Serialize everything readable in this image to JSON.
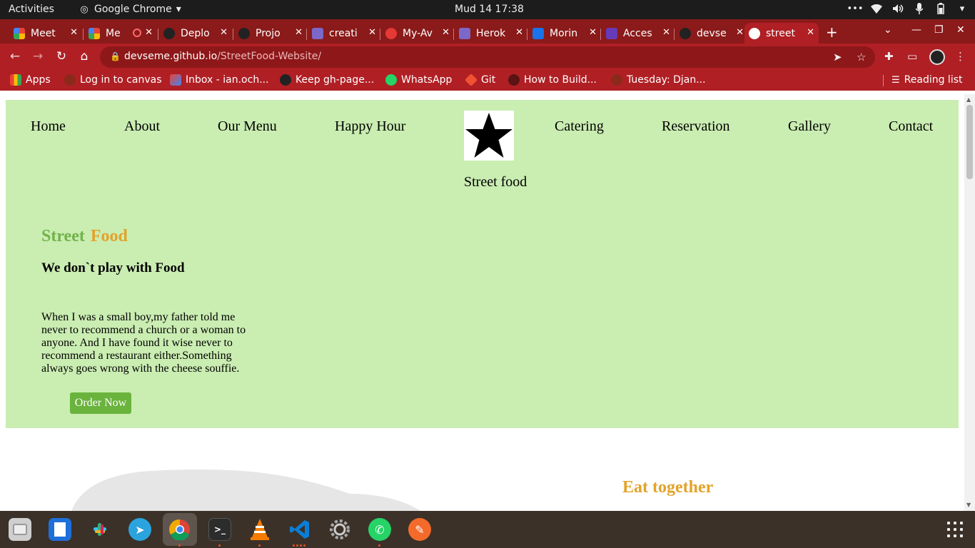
{
  "system": {
    "activities": "Activities",
    "app_name": "Google Chrome",
    "clock": "Mud 14  17:38"
  },
  "tabs": [
    {
      "title": "Meet",
      "favicon_color": "#34a853"
    },
    {
      "title": "Me",
      "favicon_color": "#34a853"
    },
    {
      "title": "Deplo",
      "favicon_color": "#222222"
    },
    {
      "title": "Projo",
      "favicon_color": "#222222"
    },
    {
      "title": "creati",
      "favicon_color": "#7b68c8"
    },
    {
      "title": "My-Av",
      "favicon_color": "#e53935"
    },
    {
      "title": "Herok",
      "favicon_color": "#7b68c8"
    },
    {
      "title": "Morin",
      "favicon_color": "#1a73e8"
    },
    {
      "title": "Acces",
      "favicon_color": "#673ab7"
    },
    {
      "title": "devse",
      "favicon_color": "#222222"
    },
    {
      "title": "street",
      "favicon_color": "#ffffff",
      "active": true
    }
  ],
  "address": {
    "domain": "devseme.github.io",
    "path": "/StreetFood-Website/"
  },
  "bookmarks": {
    "apps": "Apps",
    "items": [
      "Log in to canvas",
      "Inbox - ian.och...",
      "Keep gh-page...",
      "WhatsApp",
      "Git",
      "How to Build...",
      "Tuesday: Djan..."
    ],
    "reading_list": "Reading list"
  },
  "page": {
    "nav": [
      "Home",
      "About",
      "Our Menu",
      "Happy Hour",
      "Catering",
      "Reservation",
      "Gallery",
      "Contact"
    ],
    "logo_caption": "Street food",
    "brand_word1": "Street",
    "brand_word2": "Food",
    "tagline": "We don`t play with Food",
    "quote": "When I was a small boy,my father told me never to recommend a church or a woman to anyone. And I have found it wise never to recommend a restaurant either.Something always goes wrong with the cheese souffie.",
    "order_button": "Order Now",
    "section_heading": "Eat together"
  },
  "colors": {
    "hero_bg": "#caedb2",
    "brand_green": "#72b34a",
    "brand_orange": "#e2a32a",
    "button_green": "#6ab33c",
    "chrome_red": "#b01f24"
  }
}
